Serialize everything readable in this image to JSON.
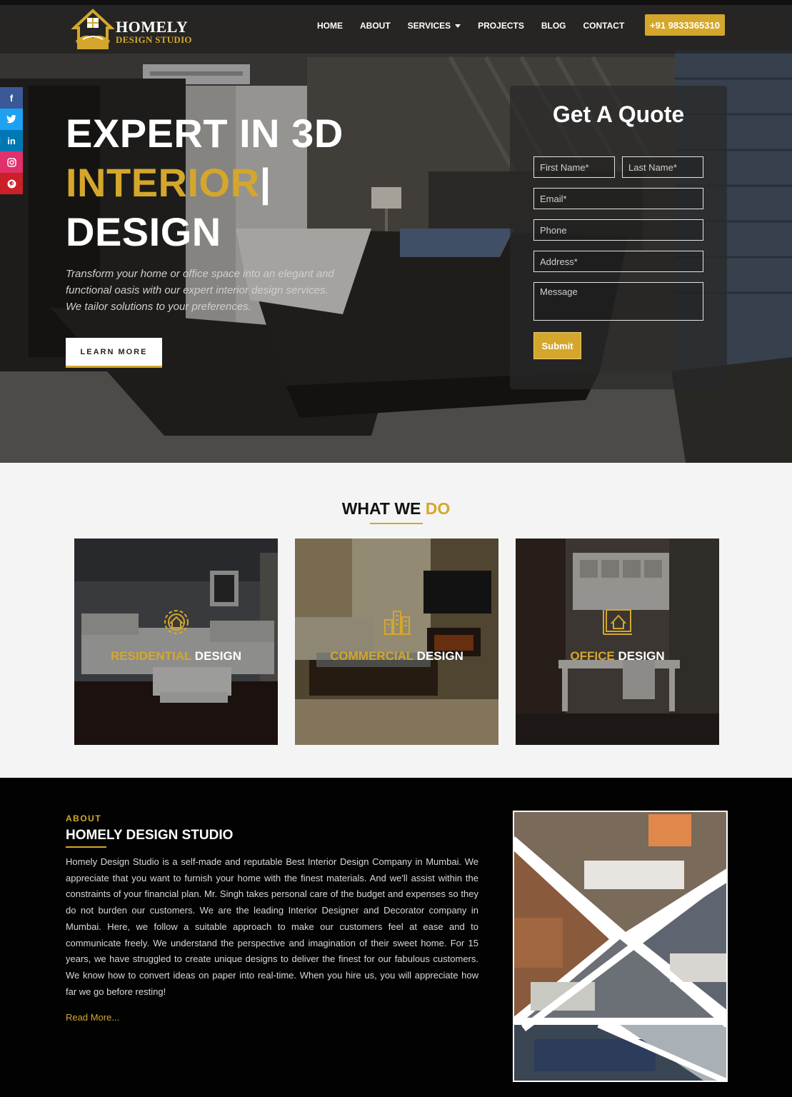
{
  "brand": {
    "name": "HOMELY",
    "tagline": "DESIGN STUDIO"
  },
  "nav": {
    "home": "HOME",
    "about": "ABOUT",
    "services": "SERVICES",
    "projects": "PROJECTS",
    "blog": "BLOG",
    "contact": "CONTACT"
  },
  "phone": "+91 9833365310",
  "social": [
    {
      "icon": "facebook-icon",
      "glyph": "f",
      "color": "#3b5998"
    },
    {
      "icon": "twitter-icon",
      "glyph": "t",
      "color": "#1da1f2"
    },
    {
      "icon": "linkedin-icon",
      "glyph": "in",
      "color": "#0077b5"
    },
    {
      "icon": "instagram-icon",
      "glyph": "◎",
      "color": "#e1306c"
    },
    {
      "icon": "pinterest-icon",
      "glyph": "℗",
      "color": "#cb2027"
    }
  ],
  "hero": {
    "line1": "EXPERT IN 3D",
    "line2": "INTERIOR",
    "cursor": "|",
    "line3": "DESIGN",
    "description": "Transform your home or office space into an elegant and functional oasis with our expert interior design services. We tailor solutions to your preferences.",
    "cta": "LEARN MORE"
  },
  "quote_form": {
    "title": "Get A Quote",
    "first_name": "First Name*",
    "last_name": "Last Name*",
    "email": "Email*",
    "phone": "Phone",
    "address": "Address*",
    "message": "Message",
    "submit": "Submit"
  },
  "services": {
    "title_a": "WHAT WE",
    "title_b": "DO",
    "items": [
      {
        "accent": "RESIDENTIAL",
        "rest": "DESIGN"
      },
      {
        "accent": "COMMERCIAL",
        "rest": "DESIGN"
      },
      {
        "accent": "OFFICE",
        "rest": "DESIGN"
      }
    ]
  },
  "about": {
    "kicker": "ABOUT",
    "title": "HOMELY DESIGN STUDIO",
    "body": "Homely Design Studio is a self-made and reputable Best Interior Design Company in Mumbai. We appreciate that you want to furnish your home with the finest materials. And we'll assist within the constraints of your financial plan. Mr. Singh takes personal care of the budget and expenses so they do not burden our customers. We are the leading Interior Designer and Decorator company in Mumbai. Here, we follow a suitable approach to make our customers feel at ease and to communicate freely. We understand the perspective and imagination of their sweet home. For 15 years, we have struggled to create unique designs to deliver the finest for our fabulous customers. We know how to convert ideas on paper into real-time. When you hire us, you will appreciate how far we go before resting!",
    "read_more": "Read More..."
  },
  "colors": {
    "accent": "#d4a72c",
    "dark": "#020202",
    "light_bg": "#f4f4f4"
  }
}
